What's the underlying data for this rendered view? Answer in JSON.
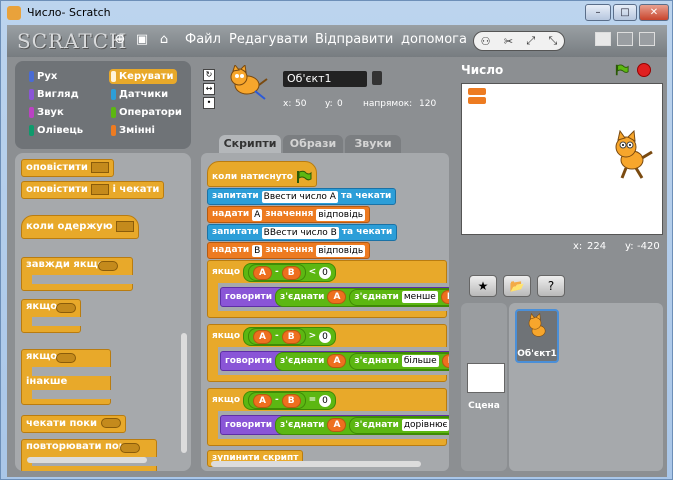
{
  "window": {
    "title": "Число- Scratch",
    "min": "–",
    "max": "□",
    "close": "✕"
  },
  "menu": {
    "logo": "SCRATCH",
    "items": [
      "Файл",
      "Редагувати",
      "Відправити",
      "допомога"
    ],
    "tools": [
      "⚇",
      "✂",
      "⤢",
      "⤡"
    ]
  },
  "categories": [
    {
      "label": "Рух",
      "color": "#4a6cd4"
    },
    {
      "label": "Керувати",
      "color": "#e8a92a"
    },
    {
      "label": "Вигляд",
      "color": "#8a55d7"
    },
    {
      "label": "Датчики",
      "color": "#2c9ed8"
    },
    {
      "label": "Звук",
      "color": "#bb42c3"
    },
    {
      "label": "Оператори",
      "color": "#5cb712"
    },
    {
      "label": "Олівець",
      "color": "#0e9a6c"
    },
    {
      "label": "Змінні",
      "color": "#ed7b21"
    }
  ],
  "palette_blocks": {
    "broadcast": "оповістити",
    "broadcast_wait": "оповістити",
    "and_wait": "і чекати",
    "when_receive": "коли одержую",
    "forever_if": "завжди якщо",
    "if": "якщо",
    "if_else": "якщо",
    "else": "інакше",
    "wait_until": "чекати поки",
    "repeat_until": "повторювати поки"
  },
  "sprite": {
    "name": "Об'єкт1",
    "x_label": "x:",
    "x": "50",
    "y_label": "y:",
    "y": "0",
    "dir_label": "напрямок:",
    "dir": "120"
  },
  "tabs": [
    "Скрипти",
    "Образи",
    "Звуки"
  ],
  "script": {
    "hat": "коли натиснуто",
    "ask1": "запитати",
    "ask1_text": "Ввести число А",
    "ask1_wait": "та чекати",
    "set1": "надати",
    "set1_var": "A",
    "set1_val": "значення",
    "set1_src": "відповідь",
    "ask2": "запитати",
    "ask2_text": "ВВести число В",
    "ask2_wait": "та чекати",
    "set2": "надати",
    "set2_var": "B",
    "set2_val": "значення",
    "set2_src": "відповідь",
    "ifs": [
      {
        "label": "якщо",
        "a": "A",
        "minus": "-",
        "b": "B",
        "cmp": "<",
        "n": "0",
        "say": "говорити",
        "join": "з'єднати",
        "join2": "з'єднати",
        "word": "менше"
      },
      {
        "label": "якщо",
        "a": "A",
        "minus": "-",
        "b": "B",
        "cmp": ">",
        "n": "0",
        "say": "говорити",
        "join": "з'єднати",
        "join2": "з'єднати",
        "word": "більше"
      },
      {
        "label": "якщо",
        "a": "A",
        "minus": "-",
        "b": "B",
        "cmp": "=",
        "n": "0",
        "say": "говорити",
        "join": "з'єднати",
        "join2": "з'єднати",
        "word": "дорівнює"
      }
    ],
    "stop": "зупинити скрипт"
  },
  "stage": {
    "title": "Число",
    "mouse_x_label": "x:",
    "mouse_x": "224",
    "mouse_y_label": "y:",
    "mouse_y": "-420"
  },
  "library": {
    "buttons": [
      "★",
      "📂",
      "?"
    ],
    "stage_label": "Сцена",
    "sprite_label": "Об'єкт1"
  }
}
